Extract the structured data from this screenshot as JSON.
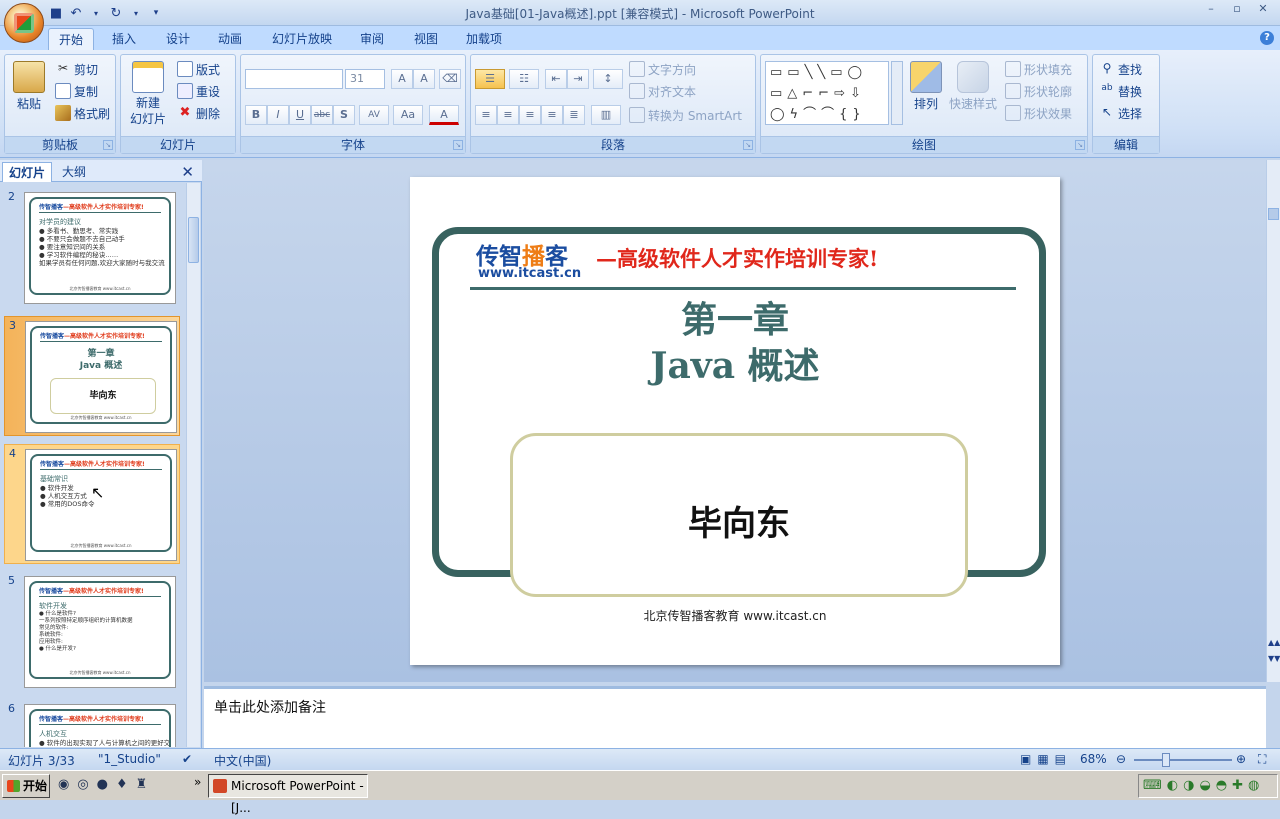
{
  "window": {
    "title": "Java基础[01-Java概述].ppt [兼容模式] - Microsoft PowerPoint",
    "min": "–",
    "max": "▫",
    "close": "✕"
  },
  "tabs": [
    {
      "label": "开始"
    },
    {
      "label": "插入"
    },
    {
      "label": "设计"
    },
    {
      "label": "动画"
    },
    {
      "label": "幻灯片放映"
    },
    {
      "label": "审阅"
    },
    {
      "label": "视图"
    },
    {
      "label": "加载项"
    }
  ],
  "ribbon": {
    "clipboard": {
      "label": "剪贴板",
      "paste": "粘贴",
      "cut": "剪切",
      "copy": "复制",
      "format_painter": "格式刷"
    },
    "slides": {
      "label": "幻灯片",
      "new_slide_1": "新建",
      "new_slide_2": "幻灯片",
      "layout": "版式",
      "reset": "重设",
      "delete": "删除"
    },
    "font": {
      "label": "字体",
      "font_size": "31"
    },
    "paragraph": {
      "label": "段落",
      "text_direction": "文字方向",
      "align_text": "对齐文本",
      "convert_smartart": "转换为 SmartArt"
    },
    "drawing": {
      "label": "绘图",
      "arrange": "排列",
      "quick_styles": "快速样式",
      "shape_fill": "形状填充",
      "shape_outline": "形状轮廓",
      "shape_effects": "形状效果"
    },
    "editing": {
      "label": "编辑",
      "find": "查找",
      "replace": "替换",
      "select": "选择"
    }
  },
  "left_pane": {
    "tab_slides": "幻灯片",
    "tab_outline": "大纲",
    "thumbnails": [
      {
        "num": "2",
        "title": "对学员的建议",
        "lines": [
          "● 多看书、勤思考、常实践",
          "● 不要只会做题不去自己动手",
          "● 要注意知识间的关系",
          "● 学习软件编程的秘诀……",
          "如果学员有任何问题,欢迎大家随时与我交流"
        ]
      },
      {
        "num": "3",
        "title": "第一章",
        "subtitle": "Java 概述",
        "author": "毕向东"
      },
      {
        "num": "4",
        "title": "基础常识",
        "lines": [
          "● 软件开发",
          "● 人机交互方式",
          "● 常用的DOS命令"
        ]
      },
      {
        "num": "5",
        "title": "软件开发",
        "lines": [
          "● 什么是软件?",
          "  一系列按照特定顺序组织的计算机数据",
          "  常见的软件:",
          "    系统软件:",
          "    应用软件:",
          "● 什么是开发?"
        ]
      },
      {
        "num": "6",
        "title": "人机交互",
        "lines": [
          "● 软件的出现实现了人与计算机之间的更好交互"
        ]
      }
    ],
    "thumb_header_a": "传智播客",
    "thumb_header_b": "—高级软件人才实作培训专家!",
    "thumb_footer": "北京传智播客教育 www.itcast.cn"
  },
  "slide": {
    "brand_a": "传智",
    "brand_b": "播",
    "brand_c": "客",
    "url": "www.itcast.cn",
    "slogan": "—高级软件人才实作培训专家!",
    "title_line1": "第一章",
    "title_line2": "Java 概述",
    "author": "毕向东",
    "footer": "北京传智播客教育   www.itcast.cn"
  },
  "notes": {
    "placeholder": "单击此处添加备注"
  },
  "status": {
    "slide_count": "幻灯片 3/33",
    "theme": "\"1_Studio\"",
    "language": "中文(中国)",
    "zoom": "68%"
  },
  "taskbar": {
    "start": "开始",
    "task": "Microsoft PowerPoint - [J..."
  },
  "colors": {
    "accent": "#38625f",
    "brand_blue": "#1b4da0",
    "brand_orange": "#ee7d16",
    "slogan_red": "#e0271b"
  }
}
